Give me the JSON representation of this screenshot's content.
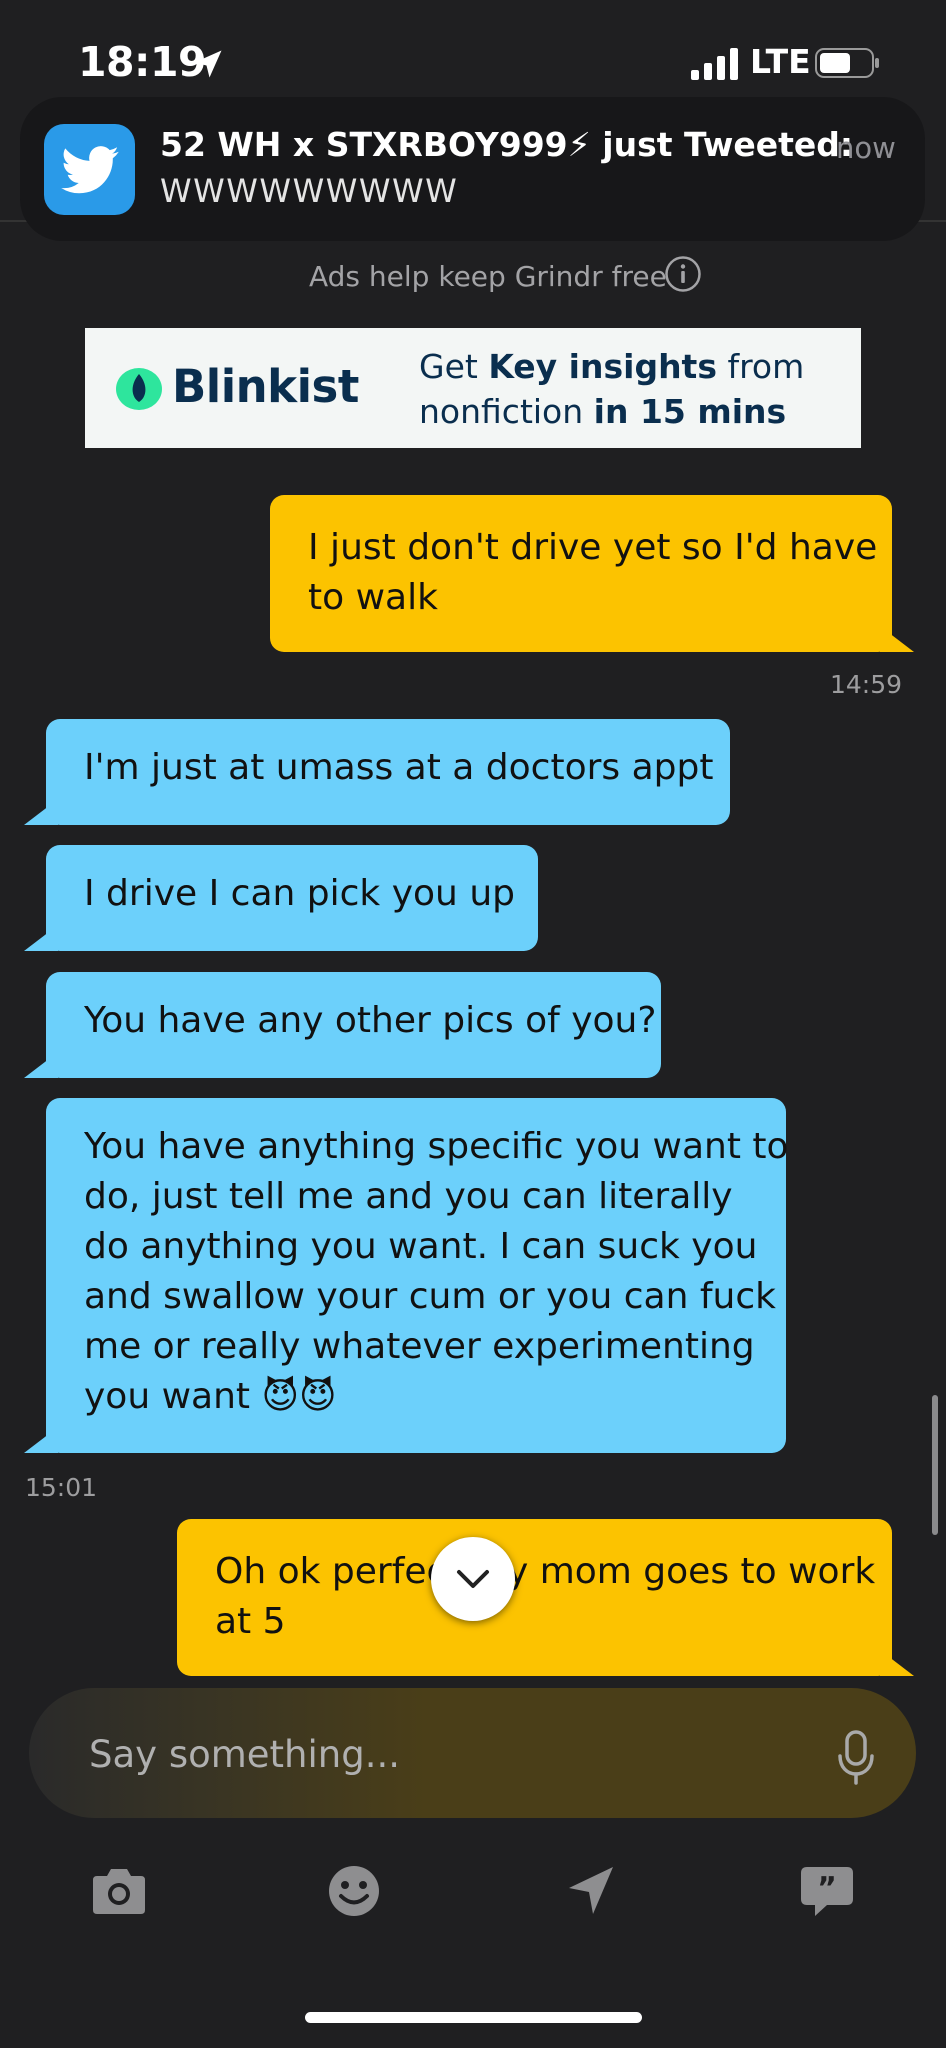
{
  "status_bar": {
    "time": "18:19",
    "network": "LTE"
  },
  "notification": {
    "app_icon": "twitter-bird-icon",
    "title": "52 WH x STXRBOY999⚡ just Tweeted:",
    "time": "now",
    "body": "WWWWWWWWW"
  },
  "ads": {
    "notice": "Ads help keep Grindr free",
    "brand": "Blinkist",
    "copy_pre1": "Get ",
    "copy_bold1": "Key insights",
    "copy_post1": " from",
    "copy_pre2": "nonfiction ",
    "copy_bold2": "in 15 mins"
  },
  "messages": [
    {
      "dir": "out",
      "lines": [
        "I just don't drive yet so I'd have",
        "to walk"
      ]
    },
    {
      "dir": "in",
      "lines": [
        "I'm just at umass at a doctors appt"
      ]
    },
    {
      "dir": "in",
      "lines": [
        "I drive I can pick you up"
      ]
    },
    {
      "dir": "in",
      "lines": [
        "You have any other pics of you?"
      ]
    },
    {
      "dir": "in",
      "lines": [
        "You have anything specific you want to",
        "do, just tell me and you can literally",
        "do anything you want. I can suck you",
        "and swallow your cum or you can fuck",
        "me or really whatever experimenting",
        "you want 😈😈"
      ]
    },
    {
      "dir": "out",
      "lines": [
        "Oh ok perfect my mom goes to work",
        "at 5"
      ]
    }
  ],
  "timestamps": {
    "t1": "14:59",
    "t2": "15:01"
  },
  "input": {
    "placeholder": "Say something..."
  },
  "toolbar": [
    "camera-icon",
    "emoji-icon",
    "location-send-icon",
    "saved-phrases-icon"
  ],
  "colors": {
    "background": "#1f1f21",
    "outgoing_bubble": "#fcc300",
    "incoming_bubble": "#6cd0fb",
    "twitter": "#2a9ae8"
  }
}
